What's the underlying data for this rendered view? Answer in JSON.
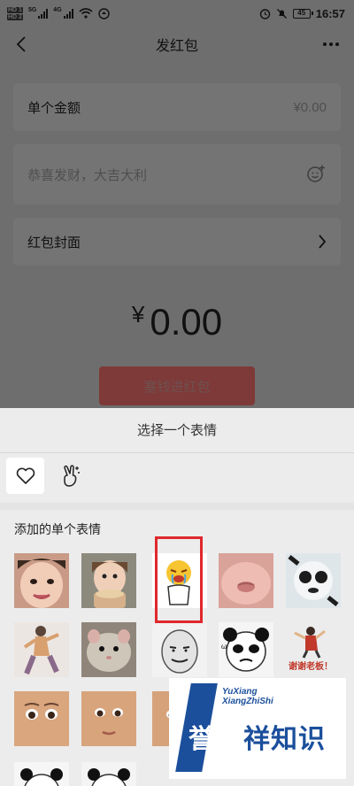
{
  "status_bar": {
    "hd1": "HD 1",
    "hd2": "HD 2",
    "sig1": "5G",
    "sig2": "4G",
    "battery": "45",
    "time": "16:57"
  },
  "nav": {
    "title": "发红包"
  },
  "form": {
    "amount_label": "单个金额",
    "amount_value": "¥0.00",
    "greeting_placeholder": "恭喜发财，大吉大利",
    "cover_label": "红包封面"
  },
  "amount_display": {
    "currency": "¥",
    "value": "0.00"
  },
  "send_button": "塞钱进红包",
  "sheet": {
    "title": "选择一个表情",
    "tabs": [
      {
        "name": "favorites",
        "icon": "heart-icon",
        "active": true
      },
      {
        "name": "sticker-pack",
        "icon": "victory-hand-icon",
        "active": false
      }
    ],
    "section_label": "添加的单个表情",
    "stickers": [
      {
        "desc": "toddler-face-photo",
        "color": "#e8b8a2"
      },
      {
        "desc": "child-eating-photo",
        "color": "#caa58c"
      },
      {
        "desc": "crying-yellow-face-cartoon",
        "color": "#ffffff"
      },
      {
        "desc": "pinched-cheek-closeup",
        "color": "#e7b0a8"
      },
      {
        "desc": "panda-meme-blurred",
        "color": "#dfe6ea"
      },
      {
        "desc": "dancing-person-cartoon",
        "color": "#e9e3df"
      },
      {
        "desc": "hamster-photo",
        "color": "#bdb3a8"
      },
      {
        "desc": "meme-face-cartoon",
        "color": "#f2f2f2"
      },
      {
        "desc": "panda-meme-face",
        "color": "#f5f5f5"
      },
      {
        "desc": "thanks-boss-sticker",
        "color": "#ececec",
        "caption": "谢谢老板！"
      },
      {
        "desc": "baby-face-closeup-1",
        "color": "#d9a67e"
      },
      {
        "desc": "baby-face-closeup-2",
        "color": "#d8a47c"
      },
      {
        "desc": "baby-face-closeup-3",
        "color": "#d6a27a"
      },
      {
        "desc": "panda-meme-small-1",
        "color": "#f6f6f6"
      },
      {
        "desc": "panda-meme-small-2",
        "color": "#f4f4f4"
      }
    ]
  },
  "watermark": {
    "top_line1": "YuXiang",
    "top_line2": "XiangZhiShi",
    "main_a": "誉祥",
    "main_b": "祥知识"
  }
}
